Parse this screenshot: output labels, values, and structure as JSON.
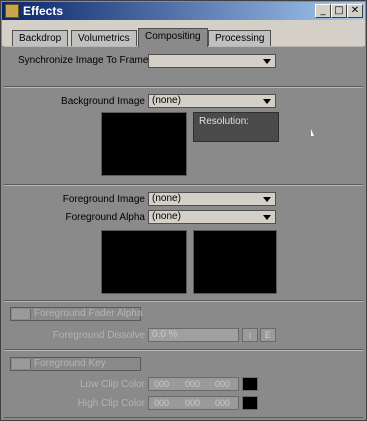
{
  "window": {
    "title": "Effects",
    "minimize": "_",
    "maximize": "□",
    "close": "✕"
  },
  "tabs": [
    {
      "label": "Backdrop"
    },
    {
      "label": "Volumetrics"
    },
    {
      "label": "Compositing"
    },
    {
      "label": "Processing"
    }
  ],
  "sync": {
    "label": "Synchronize Image To Frame",
    "value": ""
  },
  "background": {
    "label": "Background Image",
    "value": "(none)",
    "resolution_label": "Resolution:"
  },
  "foreground": {
    "image_label": "Foreground Image",
    "image_value": "(none)",
    "alpha_label": "Foreground Alpha",
    "alpha_value": "(none)"
  },
  "fader": {
    "checkbox_label": "Foreground Fader Alpha",
    "dissolve_label": "Foreground Dissolve",
    "dissolve_value": "0.0 %",
    "env_button": "E"
  },
  "key": {
    "checkbox_label": "Foreground Key",
    "low_label": "Low Clip Color",
    "low_values": [
      "000",
      "000",
      "000"
    ],
    "high_label": "High Clip Color",
    "high_values": [
      "000",
      "000",
      "000"
    ]
  }
}
